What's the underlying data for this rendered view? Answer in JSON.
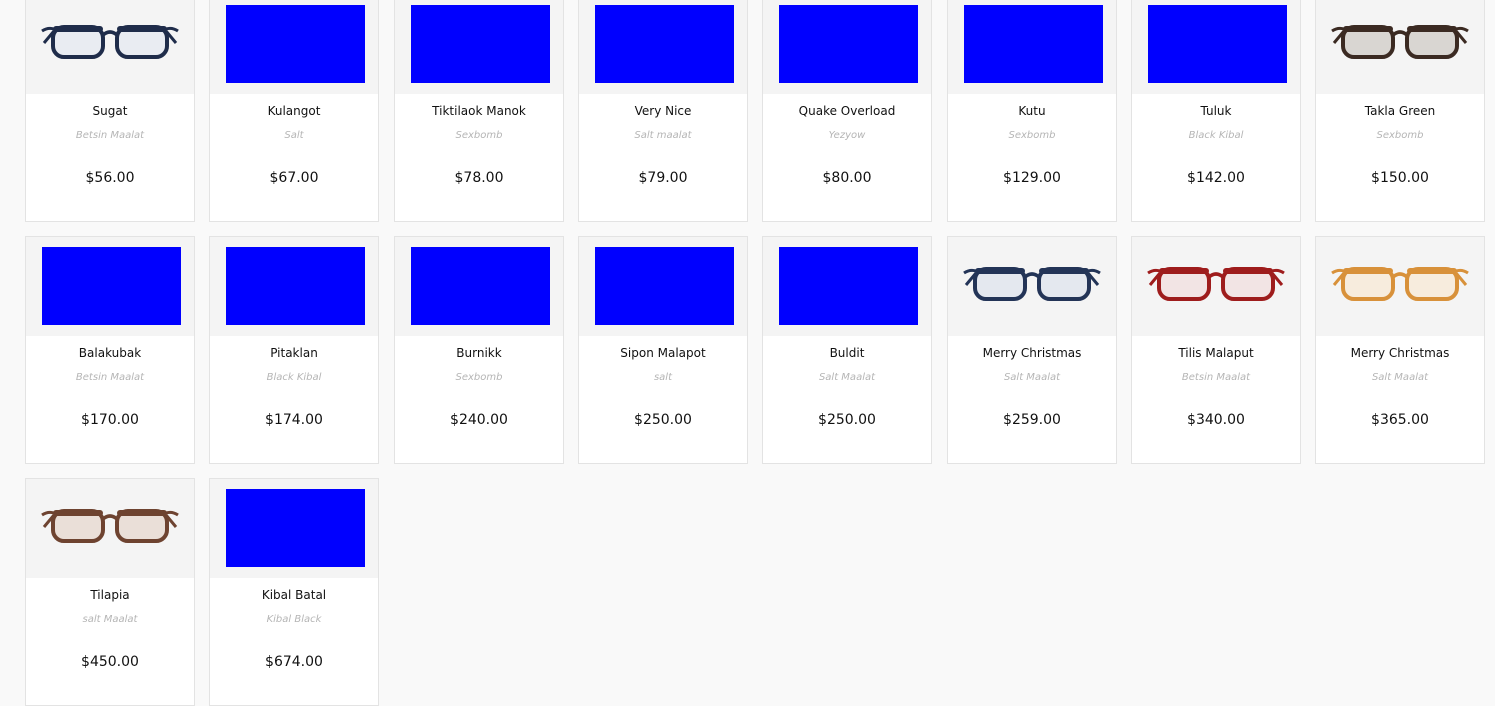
{
  "products": [
    {
      "name": "Sugat",
      "brand": "Betsin Maalat",
      "price": "$56.00",
      "image": {
        "type": "glasses",
        "frame": "#1f2c4a",
        "lens": "#e9ecf2"
      }
    },
    {
      "name": "Kulangot",
      "brand": "Salt",
      "price": "$67.00",
      "image": {
        "type": "placeholder",
        "color": "#0000ff"
      }
    },
    {
      "name": "Tiktilaok Manok",
      "brand": "Sexbomb",
      "price": "$78.00",
      "image": {
        "type": "placeholder",
        "color": "#0000ff"
      }
    },
    {
      "name": "Very Nice",
      "brand": "Salt maalat",
      "price": "$79.00",
      "image": {
        "type": "placeholder",
        "color": "#0000ff"
      }
    },
    {
      "name": "Quake Overload",
      "brand": "Yezyow",
      "price": "$80.00",
      "image": {
        "type": "placeholder",
        "color": "#0000ff"
      }
    },
    {
      "name": "Kutu",
      "brand": "Sexbomb",
      "price": "$129.00",
      "image": {
        "type": "placeholder",
        "color": "#0000ff"
      }
    },
    {
      "name": "Tuluk",
      "brand": "Black Kibal",
      "price": "$142.00",
      "image": {
        "type": "placeholder",
        "color": "#0000ff"
      }
    },
    {
      "name": "Takla Green",
      "brand": "Sexbomb",
      "price": "$150.00",
      "image": {
        "type": "glasses",
        "frame": "#3b2a22",
        "lens": "#d9d6d2"
      }
    },
    {
      "name": "Balakubak",
      "brand": "Betsin Maalat",
      "price": "$170.00",
      "image": {
        "type": "placeholder",
        "color": "#0000ff"
      }
    },
    {
      "name": "Pitaklan",
      "brand": "Black Kibal",
      "price": "$174.00",
      "image": {
        "type": "placeholder",
        "color": "#0000ff"
      }
    },
    {
      "name": "Burnikk",
      "brand": "Sexbomb",
      "price": "$240.00",
      "image": {
        "type": "placeholder",
        "color": "#0000ff"
      }
    },
    {
      "name": "Sipon Malapot",
      "brand": "salt",
      "price": "$250.00",
      "image": {
        "type": "placeholder",
        "color": "#0000ff"
      }
    },
    {
      "name": "Buldit",
      "brand": "Salt Maalat",
      "price": "$250.00",
      "image": {
        "type": "placeholder",
        "color": "#0000ff"
      }
    },
    {
      "name": "Merry Christmas",
      "brand": "Salt Maalat",
      "price": "$259.00",
      "image": {
        "type": "glasses",
        "frame": "#233457",
        "lens": "#e4e8ef"
      }
    },
    {
      "name": "Tilis Malaput",
      "brand": "Betsin Maalat",
      "price": "$340.00",
      "image": {
        "type": "glasses",
        "frame": "#9e1c1c",
        "lens": "#f2e4e4"
      }
    },
    {
      "name": "Merry Christmas",
      "brand": "Salt Maalat",
      "price": "$365.00",
      "image": {
        "type": "glasses",
        "frame": "#d8913a",
        "lens": "#f7ecdd"
      }
    },
    {
      "name": "Tilapia",
      "brand": "salt Maalat",
      "price": "$450.00",
      "image": {
        "type": "glasses",
        "frame": "#6e4330",
        "lens": "#eadfd8"
      }
    },
    {
      "name": "Kibal Batal",
      "brand": "Kibal Black",
      "price": "$674.00",
      "image": {
        "type": "placeholder",
        "color": "#0000ff"
      }
    }
  ]
}
